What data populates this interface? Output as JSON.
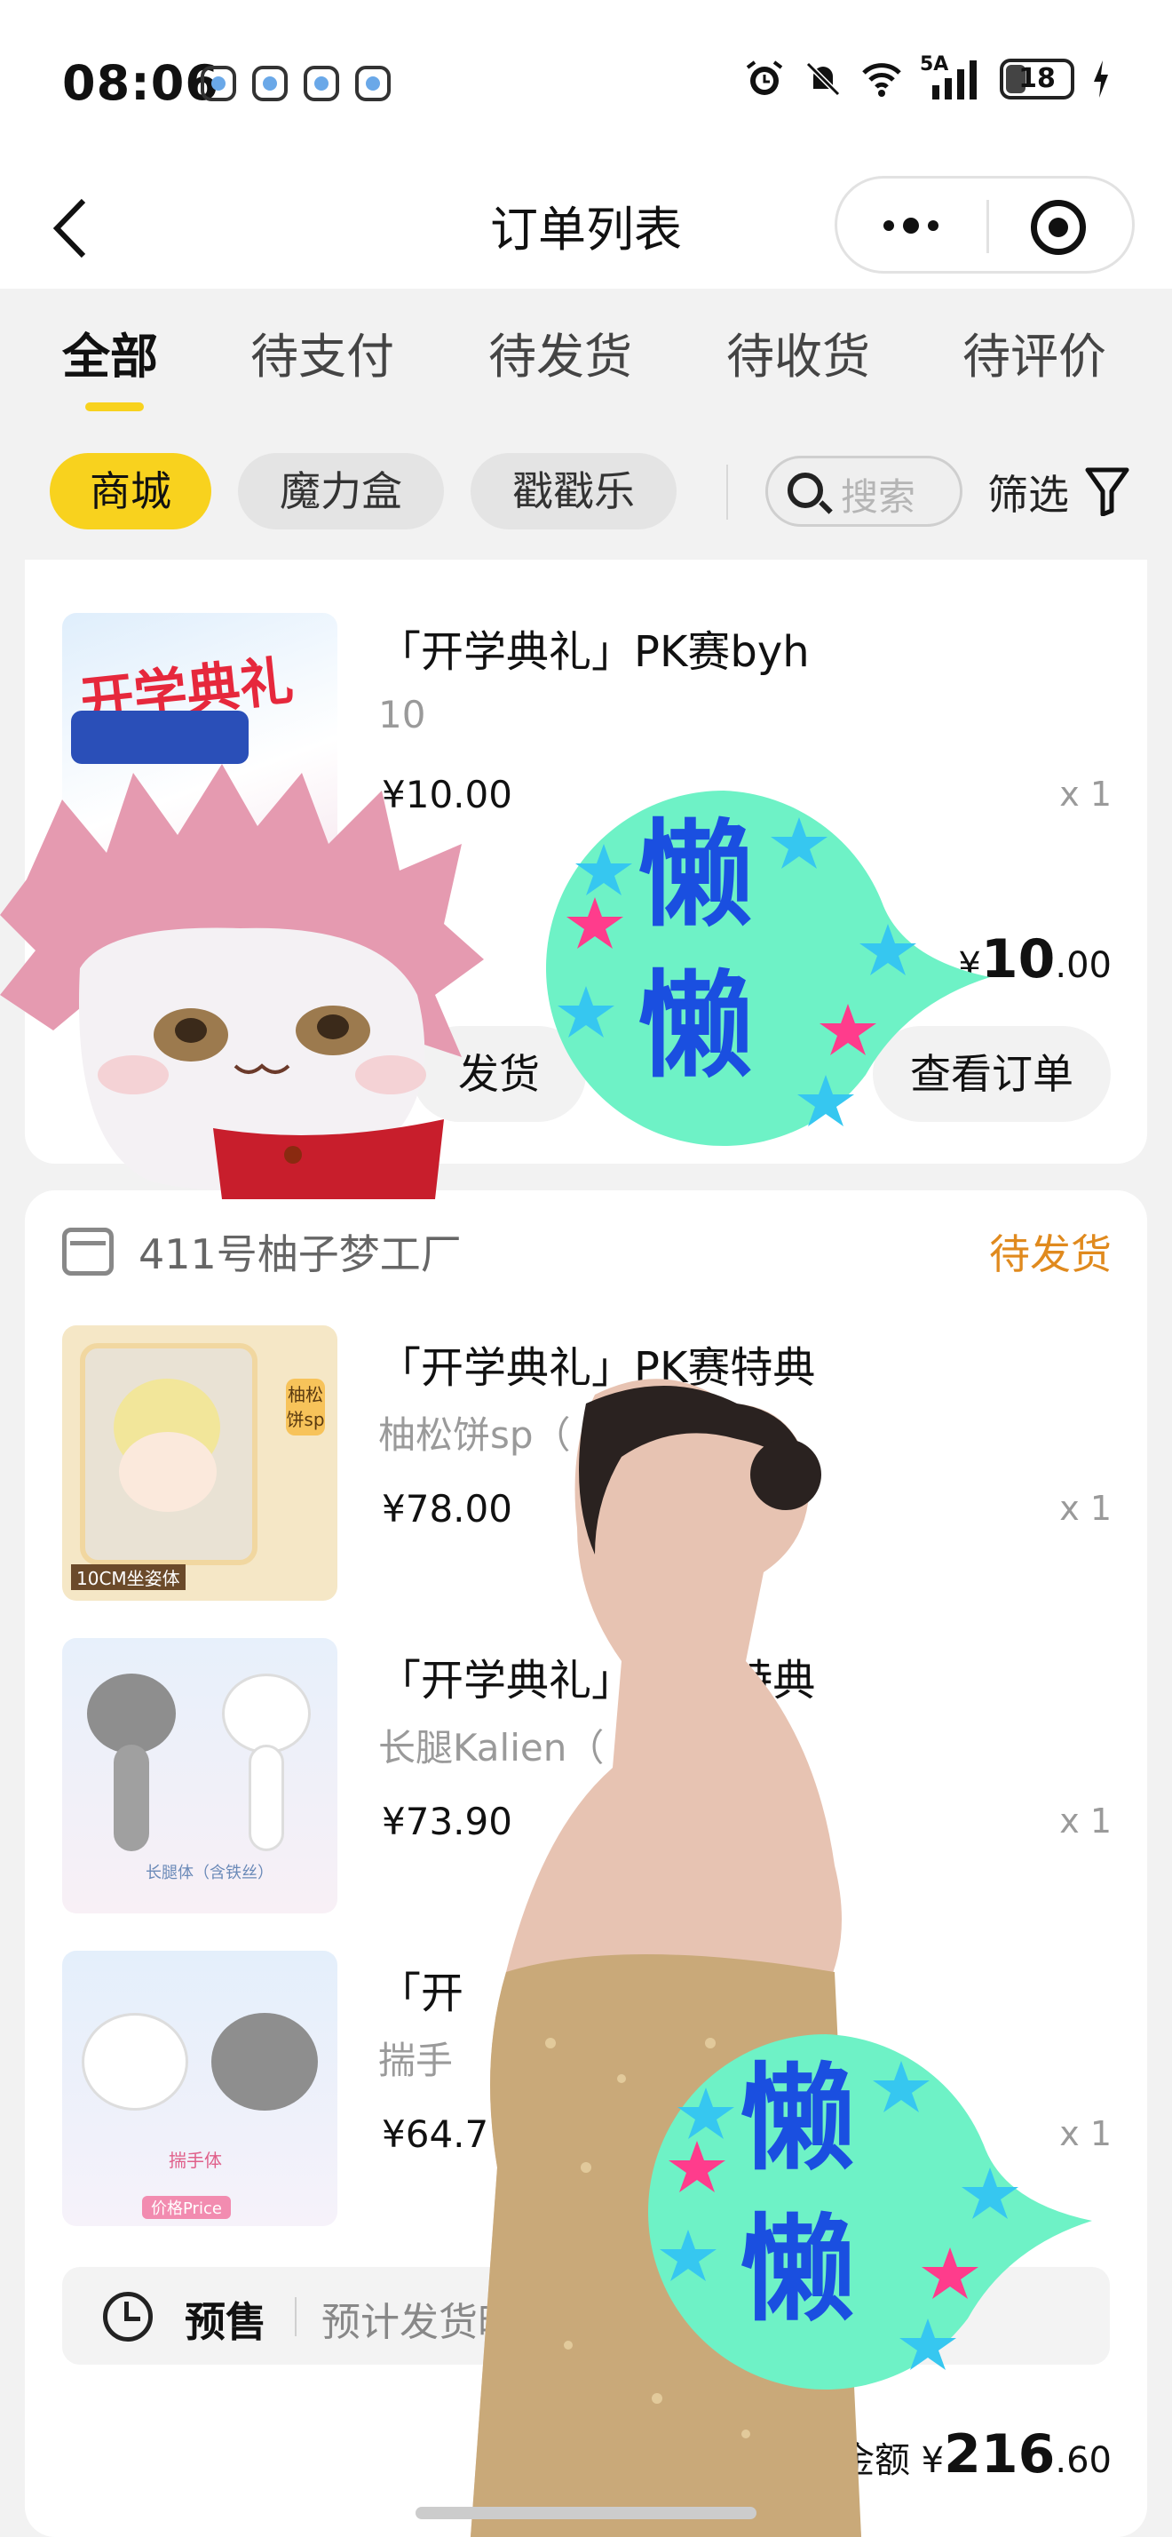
{
  "status_bar": {
    "time": "08:06",
    "network": "5A",
    "battery": "18"
  },
  "nav": {
    "title": "订单列表"
  },
  "tabs": [
    {
      "label": "全部",
      "active": true
    },
    {
      "label": "待支付",
      "active": false
    },
    {
      "label": "待发货",
      "active": false
    },
    {
      "label": "待收货",
      "active": false
    },
    {
      "label": "待评价",
      "active": false
    }
  ],
  "filters": {
    "chips": [
      "商城",
      "魔力盒",
      "戳戳乐"
    ],
    "search_placeholder": "搜索",
    "filter_label": "筛选"
  },
  "order1": {
    "item": {
      "title": "「开学典礼」PK赛byh",
      "spec": "10",
      "price": "¥10.00",
      "qty": "x 1",
      "image_text": "开学典礼"
    },
    "total_symbol": "¥",
    "total_int": "10",
    "total_dec": ".00",
    "buttons": [
      "发货",
      "查看订单"
    ]
  },
  "order2": {
    "shop_name": "411号柚子梦工厂",
    "status": "待发货",
    "items": [
      {
        "title": "「开学典礼」PK赛特典",
        "spec": "柚松饼sp（",
        "price": "¥78.00",
        "qty": "x 1",
        "image_text": "10CM坐姿体",
        "image_side_text": "柚松饼sp"
      },
      {
        "title": "「开学典礼」PK赛特典",
        "spec": "长腿Kalien（",
        "price": "¥73.90",
        "qty": "x 1",
        "image_text": "长腿体（含铁丝）"
      },
      {
        "title": "「开",
        "spec": "揣手",
        "price": "¥64.7",
        "qty": "x 1",
        "image_text": "揣手体",
        "image_tag": "价格Price"
      }
    ],
    "presale_label": "预售",
    "presale_text": "预计发货时",
    "total_label": "金额",
    "total_symbol": "¥",
    "total_int": "216",
    "total_dec": ".60"
  },
  "stickers": {
    "text": "懒懒"
  },
  "colors": {
    "accent": "#f8d21e",
    "status_orange": "#e08a1e",
    "sticker_bg": "#6ef2c6",
    "sticker_text": "#1a4fe0"
  }
}
